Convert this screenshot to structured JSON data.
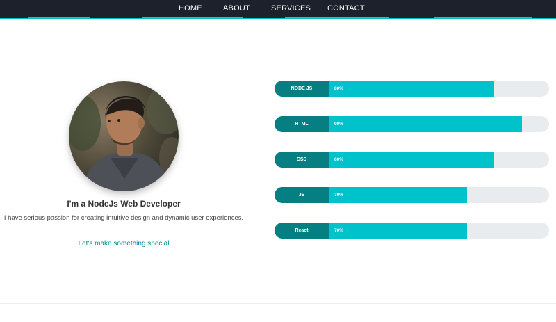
{
  "nav": {
    "items": [
      {
        "label": "HOME"
      },
      {
        "label": "ABOUT"
      },
      {
        "label": "SERVICES"
      },
      {
        "label": "CONTACT"
      }
    ]
  },
  "profile": {
    "title": "I'm a NodeJs Web Developer",
    "description": "I have serious passion for creating intuitive design and dynamic user experiences.",
    "cta_label": "Let's make something special"
  },
  "skills": [
    {
      "name": "NODE JS",
      "percent_label": "80%",
      "value": 80
    },
    {
      "name": "HTML",
      "percent_label": "90%",
      "value": 90
    },
    {
      "name": "CSS",
      "percent_label": "80%",
      "value": 80
    },
    {
      "name": "JS",
      "percent_label": "70%",
      "value": 70
    },
    {
      "name": "React",
      "percent_label": "70%",
      "value": 70
    }
  ],
  "colors": {
    "navbar_bg": "#1c212b",
    "accent": "#00c2cb",
    "skill_label_bg": "#057f81",
    "track_bg": "#e9ecef",
    "cta_text": "#008a92"
  }
}
